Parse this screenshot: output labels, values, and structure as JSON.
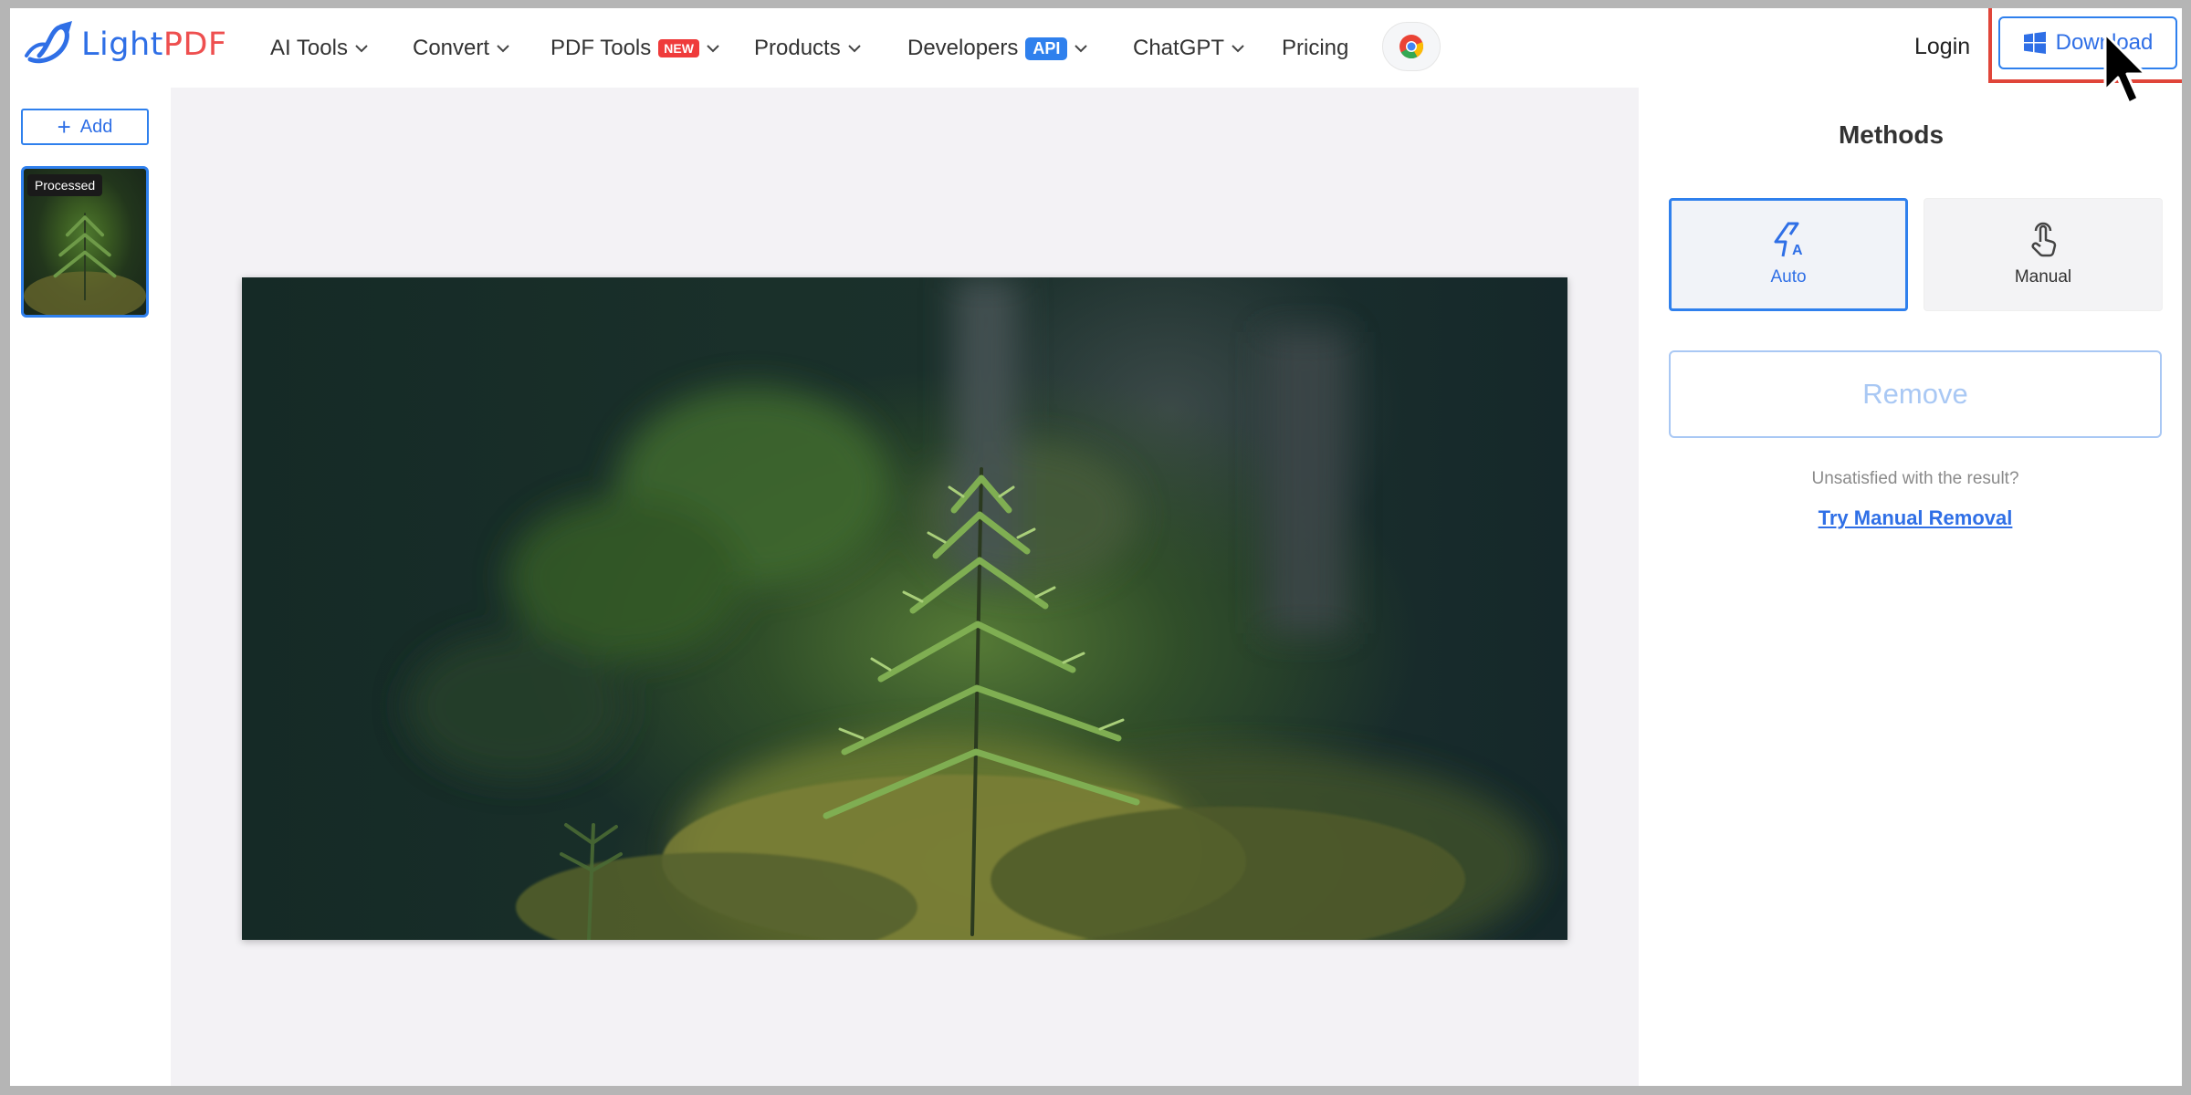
{
  "header": {
    "logo": {
      "part1": "Light",
      "part2": "PDF",
      "icon": "lightpdf-logo-icon"
    },
    "nav": [
      {
        "label": "AI Tools",
        "has_dropdown": true
      },
      {
        "label": "Convert",
        "has_dropdown": true
      },
      {
        "label": "PDF Tools",
        "badge": "NEW",
        "has_dropdown": true
      },
      {
        "label": "Products",
        "has_dropdown": true
      },
      {
        "label": "Developers",
        "badge": "API",
        "has_dropdown": true
      },
      {
        "label": "ChatGPT",
        "has_dropdown": true
      },
      {
        "label": "Pricing",
        "has_dropdown": false
      }
    ],
    "chrome_icon": "chrome-icon",
    "login_label": "Login",
    "download_label": "Download",
    "download_icon": "windows-icon"
  },
  "sidebar": {
    "add_label": "Add",
    "thumbnail": {
      "status": "Processed"
    }
  },
  "panel": {
    "title": "Methods",
    "methods": [
      {
        "label": "Auto",
        "icon": "auto-flash-icon",
        "selected": true
      },
      {
        "label": "Manual",
        "icon": "hand-pointer-icon",
        "selected": false
      }
    ],
    "remove_label": "Remove",
    "unsatisfied_text": "Unsatisfied with the result?",
    "manual_link": "Try Manual Removal"
  },
  "colors": {
    "accent": "#2f80ed",
    "logo_blue": "#2f6fe6",
    "logo_red": "#ee4f4f",
    "badge_new": "#ef3b3b",
    "highlight": "#e0453a",
    "remove_disabled": "#a9c8f4"
  }
}
